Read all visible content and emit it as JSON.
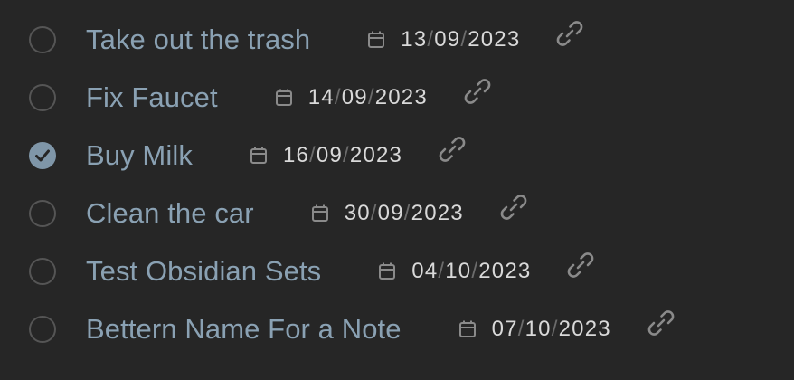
{
  "tasks": [
    {
      "title": "Take out the trash",
      "checked": false,
      "date": {
        "day": "13",
        "month": "09",
        "year": "2023",
        "sep": "/"
      }
    },
    {
      "title": "Fix Faucet",
      "checked": false,
      "date": {
        "day": "14",
        "month": "09",
        "year": "2023",
        "sep": "/"
      }
    },
    {
      "title": "Buy Milk",
      "checked": true,
      "date": {
        "day": "16",
        "month": "09",
        "year": "2023",
        "sep": "/"
      }
    },
    {
      "title": "Clean the car",
      "checked": false,
      "date": {
        "day": "30",
        "month": "09",
        "year": "2023",
        "sep": "/"
      }
    },
    {
      "title": "Test Obsidian Sets",
      "checked": false,
      "date": {
        "day": "04",
        "month": "10",
        "year": "2023",
        "sep": "/"
      }
    },
    {
      "title": "Bettern Name For a Note",
      "checked": false,
      "date": {
        "day": "07",
        "month": "10",
        "year": "2023",
        "sep": "/"
      }
    }
  ],
  "icons": {
    "checkbox": "circle-checkbox-icon",
    "date": "calendar-icon",
    "link": "link-icon"
  },
  "colors": {
    "background": "#262626",
    "title": "#8aa1b3",
    "date": "#d9d9d9",
    "checkbox_border": "#555555",
    "checkbox_checked": "#7f96a8",
    "icon": "#8a8a8a"
  }
}
